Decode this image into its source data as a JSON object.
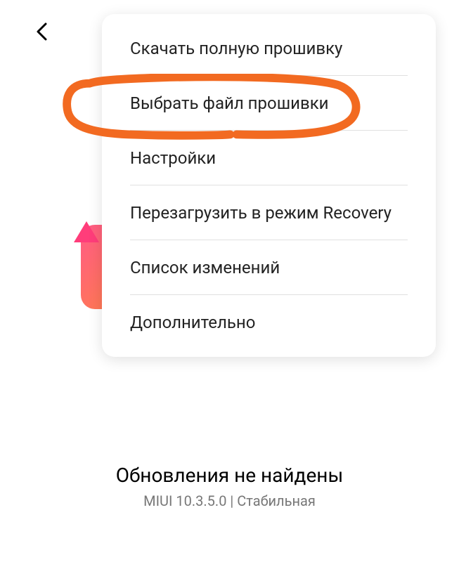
{
  "menu": {
    "items": [
      {
        "label": "Скачать полную прошивку"
      },
      {
        "label": "Выбрать файл прошивки"
      },
      {
        "label": "Настройки"
      },
      {
        "label": "Перезагрузить в режим Recovery"
      },
      {
        "label": "Список изменений"
      },
      {
        "label": "Дополнительно"
      }
    ]
  },
  "status": {
    "title": "Обновления не найдены",
    "subtitle": "MIUI 10.3.5.0 | Стабильная"
  },
  "annotation": {
    "highlighted_item_index": 1,
    "color": "#f26a21"
  }
}
